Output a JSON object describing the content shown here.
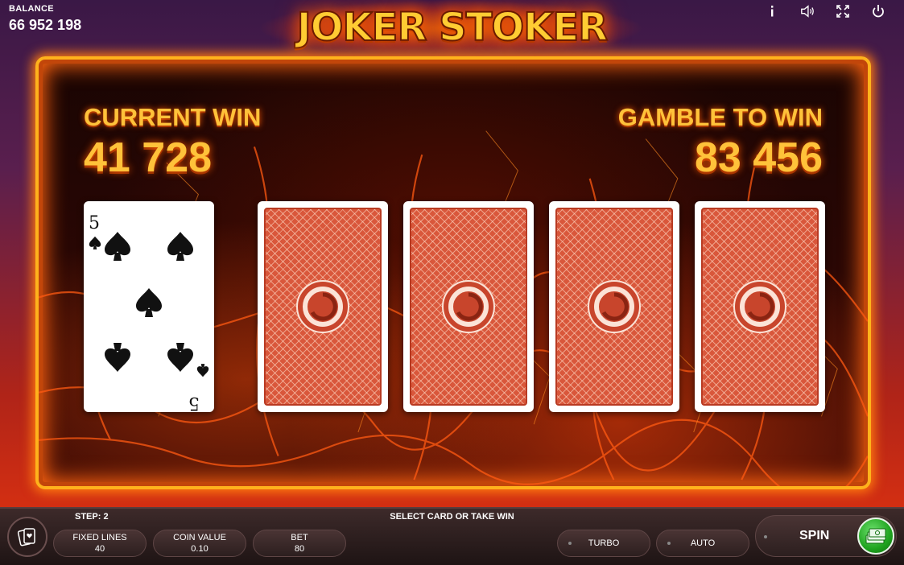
{
  "balance": {
    "label": "BALANCE",
    "value": "66 952 198"
  },
  "logo": {
    "text": "JOKER STOKER"
  },
  "top_icons": [
    "info-icon",
    "sound-icon",
    "fullscreen-icon",
    "power-icon"
  ],
  "current_win": {
    "label": "CURRENT WIN",
    "value": "41 728"
  },
  "gamble_to_win": {
    "label": "GAMBLE TO WIN",
    "value": "83 456"
  },
  "dealer_card": {
    "rank": "5",
    "suit": "spades"
  },
  "face_down_cards": 4,
  "bottom": {
    "step": "STEP: 2",
    "status": "SELECT CARD OR TAKE WIN",
    "fixed_lines": {
      "label": "FIXED LINES",
      "value": "40"
    },
    "coin_value": {
      "label": "COIN VALUE",
      "value": "0.10"
    },
    "bet": {
      "label": "BET",
      "value": "80"
    },
    "turbo": "TURBO",
    "auto": "AUTO",
    "spin": "SPIN"
  },
  "colors": {
    "gold": "#ffc23a",
    "frame": "#ffb21c",
    "card_back": "#d9573b",
    "spin_accent": "#1fa31f"
  }
}
